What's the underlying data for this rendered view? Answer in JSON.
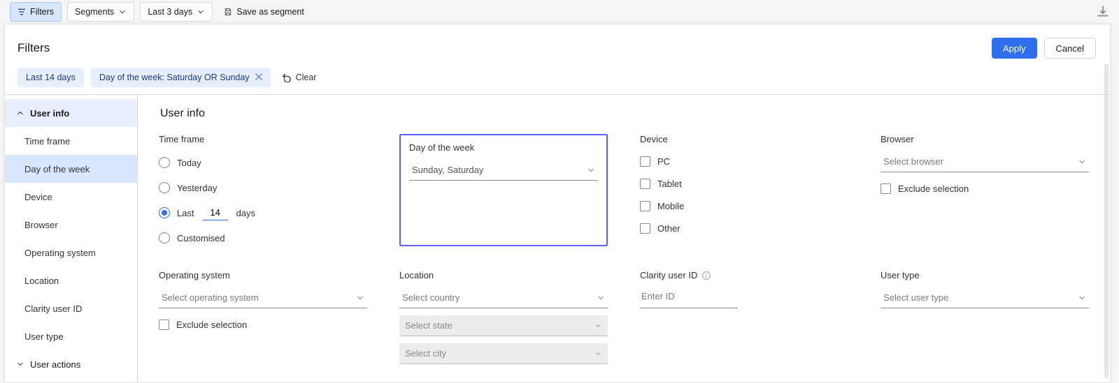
{
  "topbar": {
    "filters": "Filters",
    "segments": "Segments",
    "range": "Last 3 days",
    "save_as_segment": "Save as segment"
  },
  "panel": {
    "title": "Filters",
    "apply": "Apply",
    "cancel": "Cancel",
    "clear": "Clear"
  },
  "pills": {
    "range": "Last 14 days",
    "dow": "Day of the week: Saturday OR Sunday"
  },
  "sidebar": {
    "group_user_info": "User info",
    "items": [
      "Time frame",
      "Day of the week",
      "Device",
      "Browser",
      "Operating system",
      "Location",
      "Clarity user ID",
      "User type"
    ],
    "group_user_actions": "User actions"
  },
  "main": {
    "section_title": "User info",
    "time_frame": {
      "label": "Time frame",
      "today": "Today",
      "yesterday": "Yesterday",
      "last": "Last",
      "last_num": "14",
      "days": "days",
      "customised": "Customised"
    },
    "dow": {
      "label": "Day of the week",
      "value": "Sunday, Saturday"
    },
    "device": {
      "label": "Device",
      "opts": [
        "PC",
        "Tablet",
        "Mobile",
        "Other"
      ]
    },
    "browser": {
      "label": "Browser",
      "placeholder": "Select browser",
      "exclude": "Exclude selection"
    },
    "os": {
      "label": "Operating system",
      "placeholder": "Select operating system",
      "exclude": "Exclude selection"
    },
    "location": {
      "label": "Location",
      "country": "Select country",
      "state": "Select state",
      "city": "Select city"
    },
    "uid": {
      "label": "Clarity user ID",
      "placeholder": "Enter ID"
    },
    "utype": {
      "label": "User type",
      "placeholder": "Select user type"
    }
  }
}
